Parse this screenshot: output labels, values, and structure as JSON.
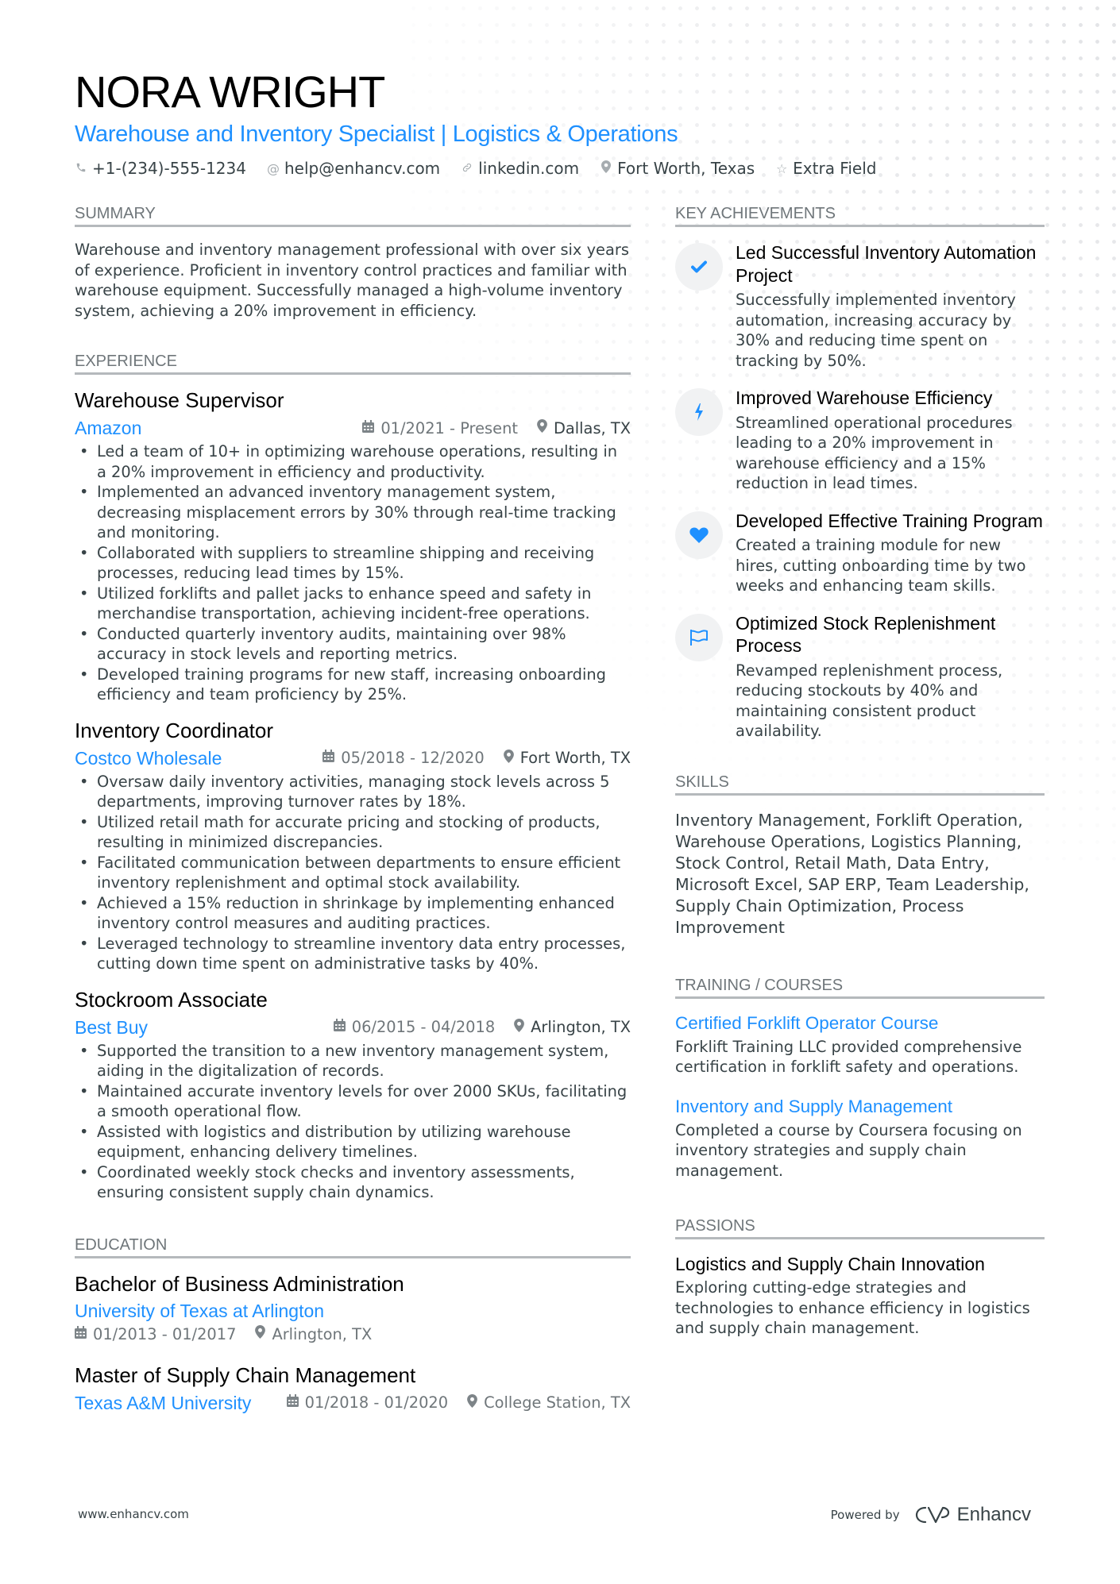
{
  "header": {
    "name": "NORA WRIGHT",
    "subtitle": "Warehouse and Inventory Specialist | Logistics & Operations",
    "contacts": [
      {
        "icon": "phone-icon",
        "glyph": "✆",
        "value": "+1-(234)-555-1234"
      },
      {
        "icon": "at-icon",
        "glyph": "@",
        "value": "help@enhancv.com"
      },
      {
        "icon": "link-icon",
        "glyph": "🔗",
        "value": "linkedin.com"
      },
      {
        "icon": "location-icon",
        "glyph": "⚲",
        "value": "Fort Worth, Texas"
      },
      {
        "icon": "star-icon",
        "glyph": "☆",
        "value": "Extra Field"
      }
    ]
  },
  "summary": {
    "title": "SUMMARY",
    "text": "Warehouse and inventory management professional with over six years of experience. Proficient in inventory control practices and familiar with warehouse equipment. Successfully managed a high-volume inventory system, achieving a 20% improvement in efficiency."
  },
  "experience": {
    "title": "EXPERIENCE",
    "items": [
      {
        "role": "Warehouse Supervisor",
        "company": "Amazon",
        "dates": "01/2021 - Present",
        "location": "Dallas, TX",
        "bullets": [
          "Led a team of 10+ in optimizing warehouse operations, resulting in a 20% improvement in efficiency and productivity.",
          "Implemented an advanced inventory management system, decreasing misplacement errors by 30% through real-time tracking and monitoring.",
          "Collaborated with suppliers to streamline shipping and receiving processes, reducing lead times by 15%.",
          "Utilized forklifts and pallet jacks to enhance speed and safety in merchandise transportation, achieving incident-free operations.",
          "Conducted quarterly inventory audits, maintaining over 98% accuracy in stock levels and reporting metrics.",
          "Developed training programs for new staff, increasing onboarding efficiency and team proficiency by 25%."
        ]
      },
      {
        "role": "Inventory Coordinator",
        "company": "Costco Wholesale",
        "dates": "05/2018 - 12/2020",
        "location": "Fort Worth, TX",
        "bullets": [
          "Oversaw daily inventory activities, managing stock levels across 5 departments, improving turnover rates by 18%.",
          "Utilized retail math for accurate pricing and stocking of products, resulting in minimized discrepancies.",
          "Facilitated communication between departments to ensure efficient inventory replenishment and optimal stock availability.",
          "Achieved a 15% reduction in shrinkage by implementing enhanced inventory control measures and auditing practices.",
          "Leveraged technology to streamline inventory data entry processes, cutting down time spent on administrative tasks by 40%."
        ]
      },
      {
        "role": "Stockroom Associate",
        "company": "Best Buy",
        "dates": "06/2015 - 04/2018",
        "location": "Arlington, TX",
        "bullets": [
          "Supported the transition to a new inventory management system, aiding in the digitalization of records.",
          "Maintained accurate inventory levels for over 2000 SKUs, facilitating a smooth operational flow.",
          "Assisted with logistics and distribution by utilizing warehouse equipment, enhancing delivery timelines.",
          "Coordinated weekly stock checks and inventory assessments, ensuring consistent supply chain dynamics."
        ]
      }
    ]
  },
  "education": {
    "title": "EDUCATION",
    "items": [
      {
        "degree": "Bachelor of Business Administration",
        "school": "University of Texas at Arlington",
        "dates": "01/2013 - 01/2017",
        "location": "Arlington, TX"
      },
      {
        "degree": "Master of Supply Chain Management",
        "school": "Texas A&M University",
        "dates": "01/2018 - 01/2020",
        "location": "College Station, TX"
      }
    ]
  },
  "achievements": {
    "title": "KEY ACHIEVEMENTS",
    "items": [
      {
        "icon": "checkmark-icon",
        "title": "Led Successful Inventory Automation Project",
        "desc": "Successfully implemented inventory automation, increasing accuracy by 30% and reducing time spent on tracking by 50%."
      },
      {
        "icon": "lightning-bolt-icon",
        "title": "Improved Warehouse Efficiency",
        "desc": "Streamlined operational procedures leading to a 20% improvement in warehouse efficiency and a 15% reduction in lead times."
      },
      {
        "icon": "heart-icon",
        "title": "Developed Effective Training Program",
        "desc": "Created a training module for new hires, cutting onboarding time by two weeks and enhancing team skills."
      },
      {
        "icon": "flag-icon",
        "title": "Optimized Stock Replenishment Process",
        "desc": "Revamped replenishment process, reducing stockouts by 40% and maintaining consistent product availability."
      }
    ]
  },
  "skills": {
    "title": "SKILLS",
    "text": "Inventory Management, Forklift Operation, Warehouse Operations, Logistics Planning, Stock Control, Retail Math, Data Entry, Microsoft Excel, SAP ERP, Team Leadership, Supply Chain Optimization, Process Improvement"
  },
  "training": {
    "title": "TRAINING / COURSES",
    "items": [
      {
        "title": "Certified Forklift Operator Course",
        "desc": "Forklift Training LLC provided comprehensive certification in forklift safety and operations."
      },
      {
        "title": "Inventory and Supply Management",
        "desc": "Completed a course by Coursera focusing on inventory strategies and supply chain management."
      }
    ]
  },
  "passions": {
    "title": "PASSIONS",
    "items": [
      {
        "title": "Logistics and Supply Chain Innovation",
        "desc": "Exploring cutting-edge strategies and technologies to enhance efficiency in logistics and supply chain management."
      }
    ]
  },
  "footer": {
    "website": "www.enhancv.com",
    "powered_by": "Powered by",
    "brand": "Enhancv"
  },
  "colors": {
    "accent": "#1e90ff",
    "text": "#384347",
    "heading": "#000000",
    "section_title": "#6f767a",
    "rule": "#b5b9bc",
    "icon_bg": "#f1f2f3"
  }
}
